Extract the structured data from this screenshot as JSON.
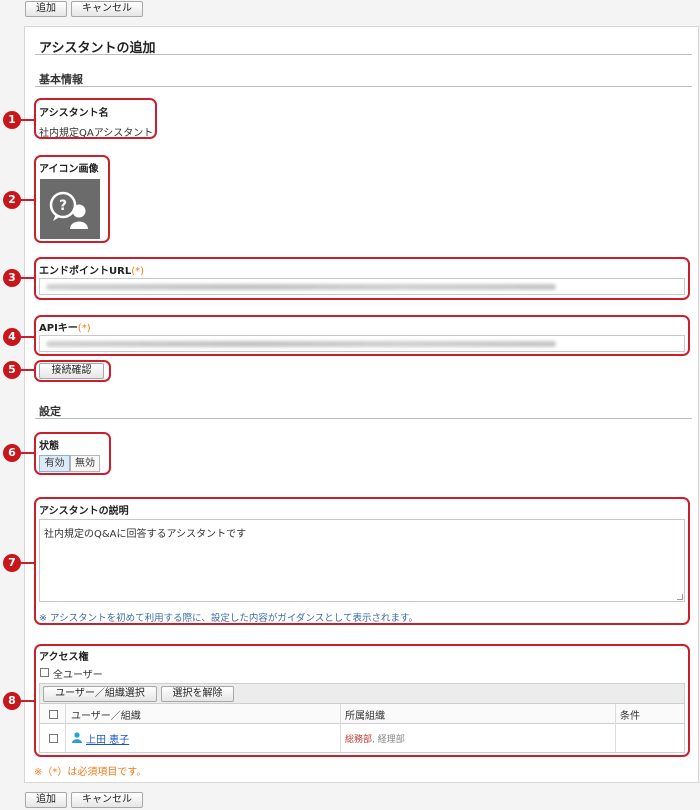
{
  "toolbar": {
    "add_label": "追加",
    "cancel_label": "キャンセル"
  },
  "page": {
    "title": "アシスタントの追加",
    "basic_section": "基本情報",
    "settings_section": "設定"
  },
  "assistant_name": {
    "label": "アシスタント名",
    "value": "社内規定QAアシスタント"
  },
  "icon_image": {
    "label": "アイコン画像",
    "icon": "question-chat-user-icon"
  },
  "endpoint": {
    "label": "エンドポイントURL",
    "required": "(*)"
  },
  "api_key": {
    "label": "APIキー",
    "required": "(*)"
  },
  "connection_check_label": "接続確認",
  "status": {
    "label": "状態",
    "enabled": "有効",
    "disabled": "無効",
    "selected": "有効"
  },
  "description": {
    "label": "アシスタントの説明",
    "value": "社内規定のQ&Aに回答するアシスタントです",
    "note": "※ アシスタントを初めて利用する際に、設定した内容がガイダンスとして表示されます。"
  },
  "access": {
    "label": "アクセス権",
    "all_users": "全ユーザー",
    "select_button": "ユーザー／組織選択",
    "clear_button": "選択を解除",
    "columns": [
      "ユーザー／組織",
      "所属組織",
      "条件"
    ],
    "rows": [
      {
        "name": "上田 恵子",
        "org_primary": "総務部",
        "org_separator": ", ",
        "org_secondary": "経理部",
        "condition": ""
      }
    ]
  },
  "required_note": "※（*）は必須項目です。",
  "callouts": [
    "1",
    "2",
    "3",
    "4",
    "5",
    "6",
    "7",
    "8"
  ],
  "colors": {
    "callout_red": "#c8161d",
    "required_orange": "#f07a1a",
    "link_blue": "#1a55c8",
    "note_blue": "#3a6ea5"
  }
}
